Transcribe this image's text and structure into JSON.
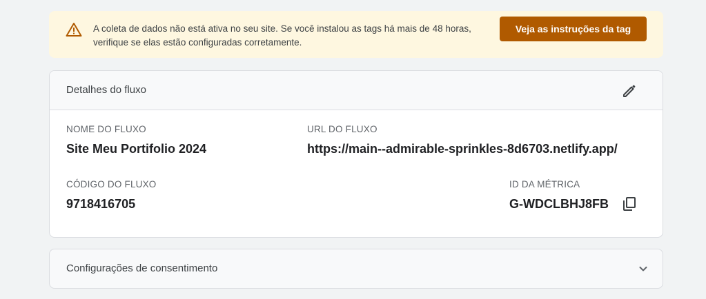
{
  "alert": {
    "icon": "warning-icon",
    "message": "A coleta de dados não está ativa no seu site. Se você instalou as tags há mais de 48 horas, verifique se elas estão configuradas corretamente.",
    "button_label": "Veja as instruções da tag",
    "button_color": "#b05a00",
    "background_color": "#fef7e0"
  },
  "stream_details": {
    "title": "Detalhes do fluxo",
    "edit_icon": "pencil-icon",
    "stream_name_label": "NOME DO FLUXO",
    "stream_name": "Site Meu Portifolio 2024",
    "stream_url_label": "URL DO FLUXO",
    "stream_url": "https://main--admirable-sprinkles-8d6703.netlify.app/",
    "stream_code_label": "CÓDIGO DO FLUXO",
    "stream_code": "9718416705",
    "measurement_id_label": "ID DA MÉTRICA",
    "measurement_id": "G-WDCLBHJ8FB",
    "copy_icon": "copy-icon"
  },
  "consent": {
    "title": "Configurações de consentimento",
    "expand_icon": "chevron-down-icon"
  }
}
